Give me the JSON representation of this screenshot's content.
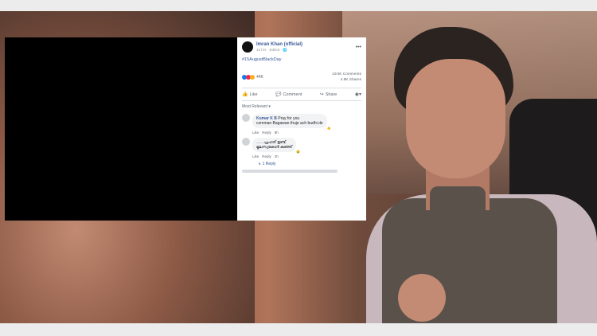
{
  "post": {
    "author": "Imran Khan (official)",
    "meta": "15 hrs · Edited · 🌐",
    "hashtag": "#15AugustBlackDay",
    "reaction_count": "44K",
    "comments_count": "12/4K Comments",
    "shares_count": "4.8K Shares",
    "actions": {
      "like": "Like",
      "comment": "Comment",
      "share": "Share"
    },
    "sort_label": "Most Relevant ▾",
    "comments": [
      {
        "name": "Kumar K B",
        "text": "Pray for you",
        "text2": "comman Bagawan thuje ach budhi de",
        "links": [
          "Like",
          "Reply",
          "8h"
        ]
      },
      {
        "name": "",
        "text": "……പ്രഹര് ഉണ്ട്",
        "text2": "മൂലസ്വകോർ കുഞ്ഞ്",
        "links": [
          "Like",
          "Reply",
          "2h"
        ]
      }
    ],
    "reply_link": "↳ 1 Reply"
  },
  "colors": {
    "link": "#385898",
    "like_blue": "#1877f2",
    "love_red": "#f02849",
    "wow_yellow": "#f7b125"
  }
}
